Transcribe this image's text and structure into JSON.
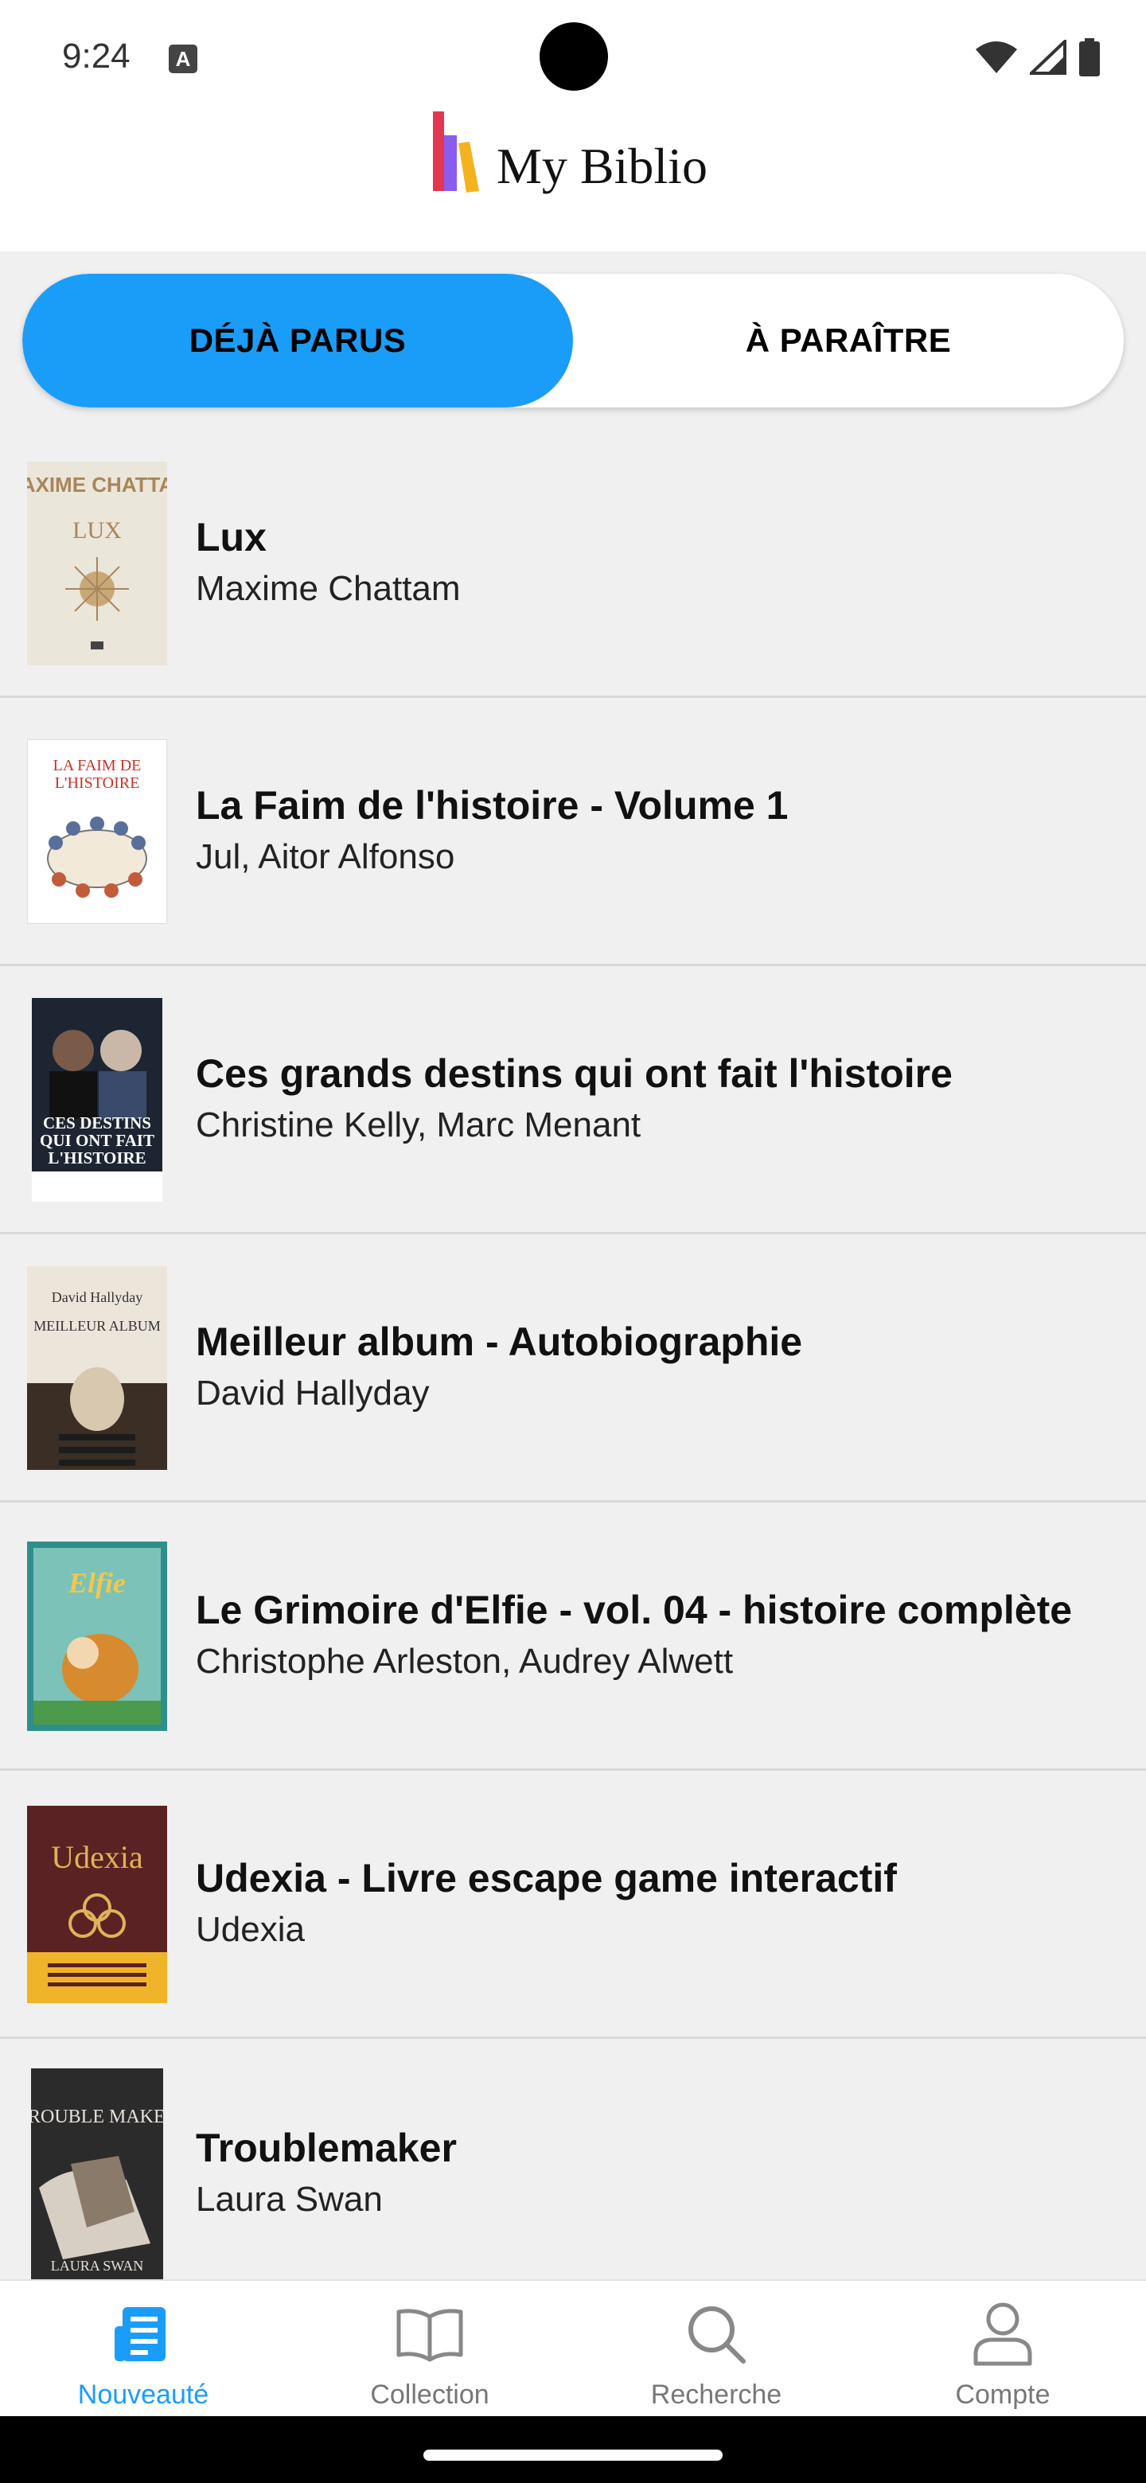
{
  "status_bar": {
    "time": "9:24",
    "notification_glyph": "A"
  },
  "header": {
    "title": "My Biblio"
  },
  "tabs": [
    {
      "label": "DÉJÀ PARUS",
      "active": true
    },
    {
      "label": "À PARAÎTRE",
      "active": false
    }
  ],
  "books": [
    {
      "title": "Lux",
      "author": "Maxime Chattam",
      "cover_text_top": "MAXIME CHATTAM",
      "cover_text_main": "LUX",
      "cover_colors": [
        "#e9e4d8",
        "#a8855a"
      ]
    },
    {
      "title": "La Faim de l'histoire - Volume 1",
      "author": "Jul, Aitor Alfonso",
      "cover_text_main": "LA FAIM DE L'HISTOIRE",
      "cover_colors": [
        "#ffffff",
        "#c9322a"
      ]
    },
    {
      "title": "Ces grands destins qui ont fait l'histoire",
      "author": "Christine Kelly, Marc Menant",
      "cover_text_main": "CES DESTINS QUI ONT FAIT L'HISTOIRE",
      "cover_colors": [
        "#1d2533",
        "#ffffff"
      ]
    },
    {
      "title": "Meilleur album - Autobiographie",
      "author": "David Hallyday",
      "cover_text_top": "David Hallyday",
      "cover_text_main": "MEILLEUR ALBUM",
      "cover_colors": [
        "#ece6da",
        "#3a2e25"
      ]
    },
    {
      "title": "Le Grimoire d'Elfie - vol. 04 - histoire complète",
      "author": "Christophe Arleston, Audrey Alwett",
      "cover_text_main": "Elfie",
      "cover_colors": [
        "#2e8f8a",
        "#d88a2e"
      ]
    },
    {
      "title": "Udexia - Livre escape game interactif",
      "author": "Udexia",
      "cover_text_main": "Udexia",
      "cover_colors": [
        "#5a2222",
        "#f0b42a"
      ]
    },
    {
      "title": "Troublemaker",
      "author": "Laura Swan",
      "cover_text_main": "TROUBLE MAKER",
      "cover_text_bottom": "LAURA SWAN",
      "cover_colors": [
        "#2b2b2b",
        "#e6e0d8"
      ]
    }
  ],
  "bottom_nav": [
    {
      "label": "Nouveauté",
      "icon": "newspaper-icon",
      "active": true
    },
    {
      "label": "Collection",
      "icon": "book-open-icon",
      "active": false
    },
    {
      "label": "Recherche",
      "icon": "search-icon",
      "active": false
    },
    {
      "label": "Compte",
      "icon": "person-icon",
      "active": false
    }
  ],
  "colors": {
    "accent": "#1a9df9",
    "background": "#f0f0f0",
    "divider": "#d8d8d8"
  }
}
